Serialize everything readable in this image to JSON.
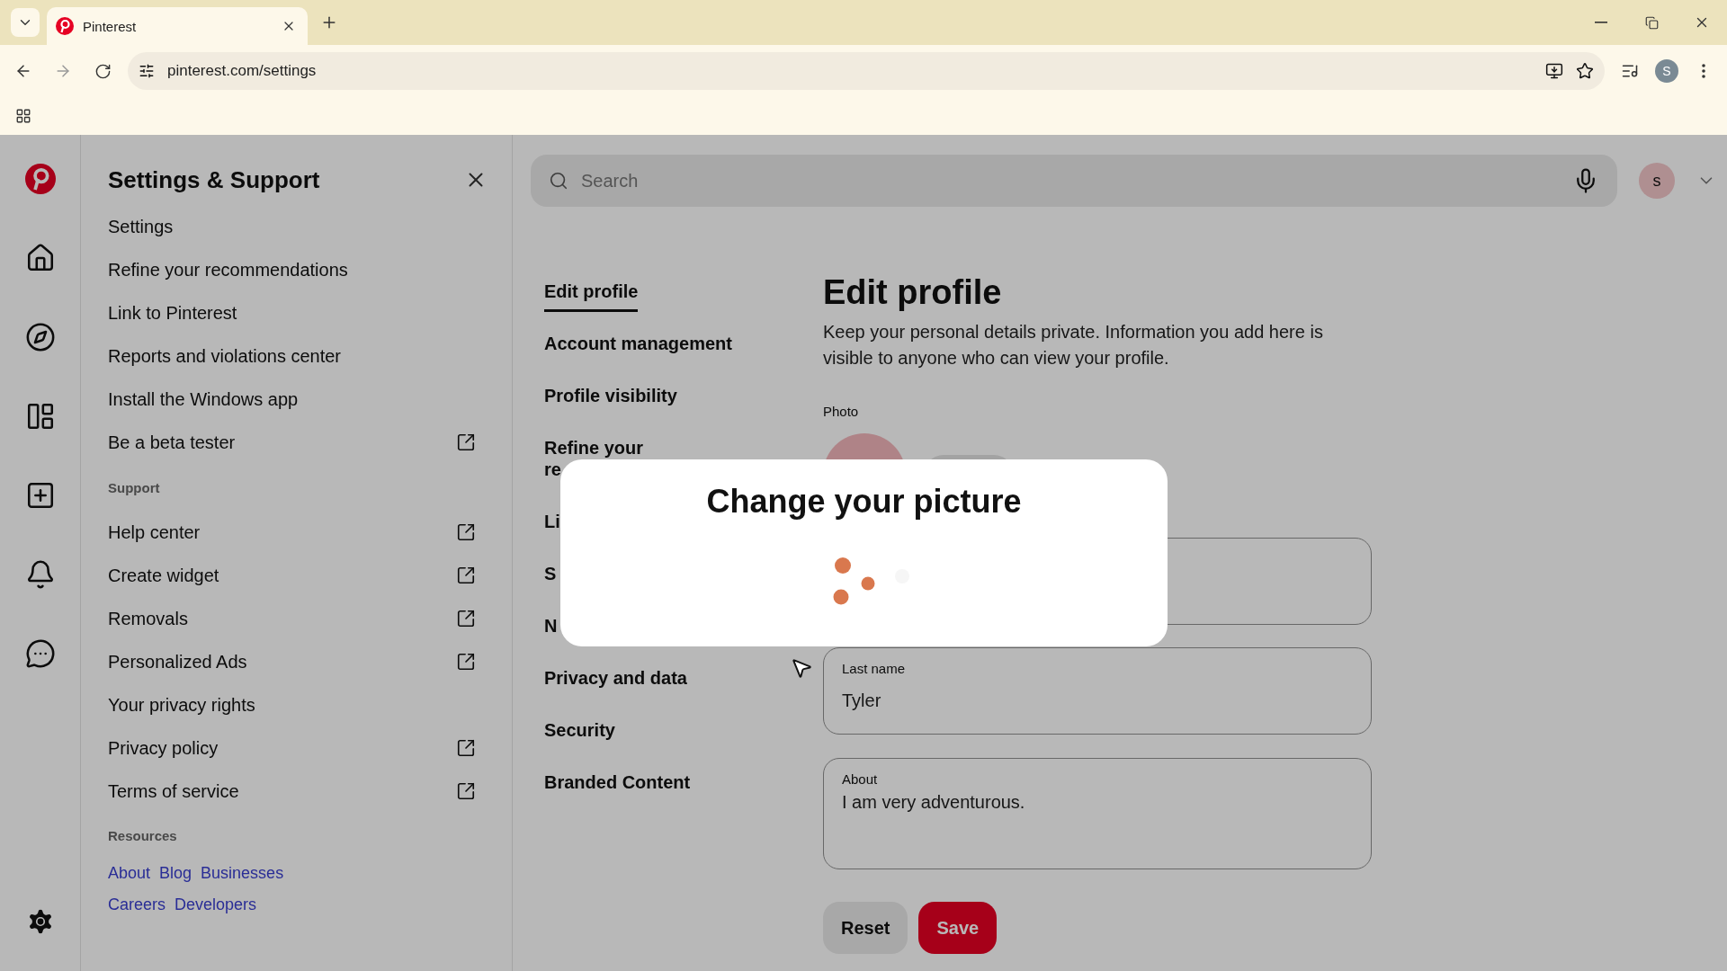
{
  "browser": {
    "tab_title": "Pinterest",
    "url": "pinterest.com/settings",
    "profile_initial": "S"
  },
  "settings_panel": {
    "title": "Settings & Support",
    "groups": [
      {
        "items": [
          {
            "label": "Settings",
            "external": false
          },
          {
            "label": "Refine your recommendations",
            "external": false
          },
          {
            "label": "Link to Pinterest",
            "external": false
          },
          {
            "label": "Reports and violations center",
            "external": false
          },
          {
            "label": "Install the Windows app",
            "external": false
          },
          {
            "label": "Be a beta tester",
            "external": true
          }
        ]
      },
      {
        "heading": "Support",
        "items": [
          {
            "label": "Help center",
            "external": true
          },
          {
            "label": "Create widget",
            "external": true
          },
          {
            "label": "Removals",
            "external": true
          },
          {
            "label": "Personalized Ads",
            "external": true
          },
          {
            "label": "Your privacy rights",
            "external": false
          },
          {
            "label": "Privacy policy",
            "external": true
          },
          {
            "label": "Terms of service",
            "external": true
          }
        ]
      }
    ],
    "resources": {
      "heading": "Resources",
      "link_rows": [
        [
          "About",
          "Blog",
          "Businesses"
        ],
        [
          "Careers",
          "Developers"
        ]
      ]
    }
  },
  "search": {
    "placeholder": "Search",
    "avatar_initial": "s"
  },
  "nav": [
    {
      "label": "Edit profile",
      "selected": true
    },
    {
      "label": "Account management",
      "selected": false
    },
    {
      "label": "Profile visibility",
      "selected": false
    },
    {
      "label": "Refine your\nre",
      "selected": false
    },
    {
      "label": "Li",
      "selected": false
    },
    {
      "label": "S",
      "selected": false
    },
    {
      "label": "N",
      "selected": false
    },
    {
      "label": "Privacy and data",
      "selected": false
    },
    {
      "label": "Security",
      "selected": false
    },
    {
      "label": "Branded Content",
      "selected": false
    }
  ],
  "edit_profile": {
    "title": "Edit profile",
    "description": "Keep your personal details private. Information you add here is visible to anyone who can view your profile.",
    "photo_label": "Photo",
    "fields": [
      {
        "kind": "input",
        "label": "Last name",
        "value": "Tyler"
      },
      {
        "kind": "textarea",
        "label": "About",
        "value": "I am very adventurous."
      }
    ],
    "buttons": [
      {
        "kind": "secondary",
        "label": "Reset"
      },
      {
        "kind": "primary",
        "label": "Save"
      }
    ]
  },
  "modal": {
    "title": "Change your picture"
  }
}
